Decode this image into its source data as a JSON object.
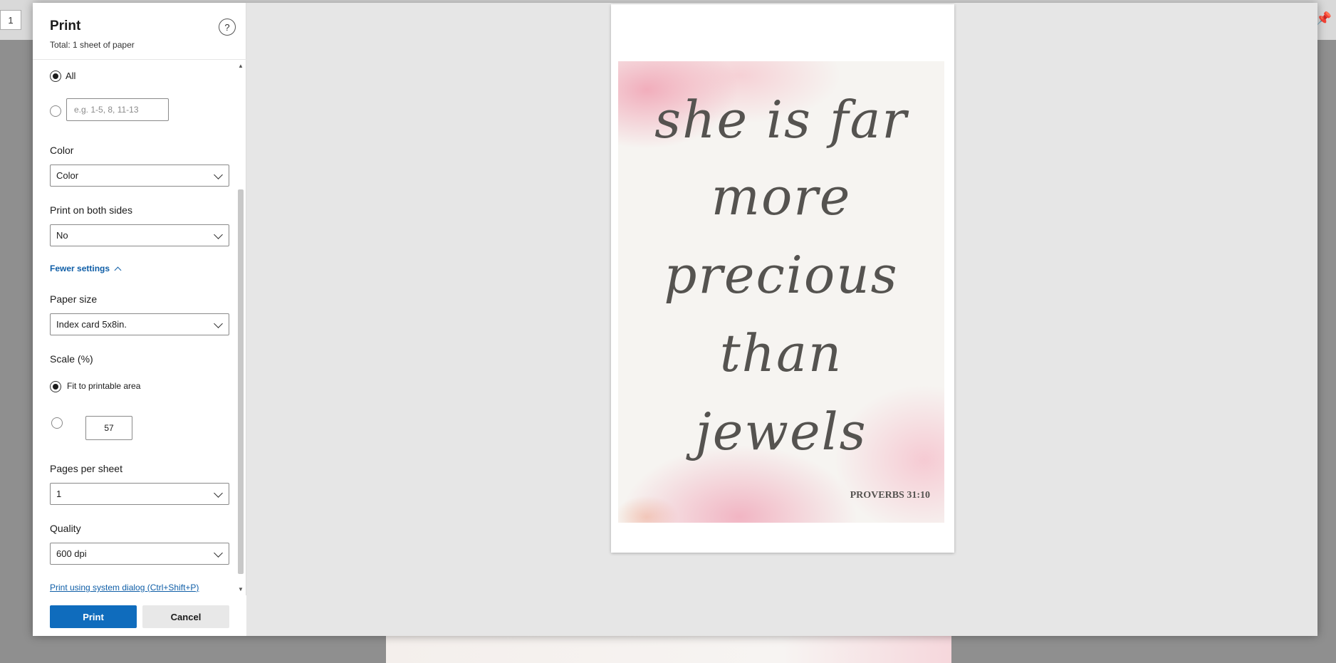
{
  "background": {
    "page_number": "1"
  },
  "panel": {
    "title": "Print",
    "subtitle": "Total: 1 sheet of paper",
    "help_icon": "?",
    "pages": {
      "all_label": "All",
      "custom_placeholder": "e.g. 1-5, 8, 11-13"
    },
    "color": {
      "label": "Color",
      "value": "Color"
    },
    "duplex": {
      "label": "Print on both sides",
      "value": "No"
    },
    "fewer_settings": "Fewer settings",
    "paper_size": {
      "label": "Paper size",
      "value": "Index card 5x8in."
    },
    "scale": {
      "label": "Scale (%)",
      "fit_label": "Fit to printable area",
      "custom_value": "57"
    },
    "pages_per_sheet": {
      "label": "Pages per sheet",
      "value": "1"
    },
    "quality": {
      "label": "Quality",
      "value": "600 dpi"
    },
    "system_dialog_link": "Print using system dialog (Ctrl+Shift+P)",
    "print_button": "Print",
    "cancel_button": "Cancel"
  },
  "preview": {
    "quote_lines": [
      "she is far",
      "more",
      "precious",
      "than",
      "jewels"
    ],
    "reference": "PROVERBS 31:10"
  },
  "colors": {
    "accent": "#0f6cbd",
    "link": "#0f5ea7",
    "preview_bg": "#e6e6e6"
  }
}
